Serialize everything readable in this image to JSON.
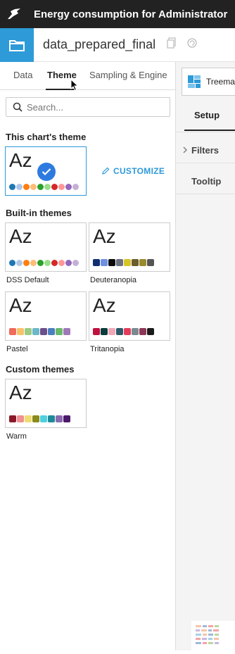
{
  "app": {
    "title": "Energy consumption for Administrator",
    "dataset_name": "data_prepared_final"
  },
  "tabs": [
    {
      "label": "Data"
    },
    {
      "label": "Theme"
    },
    {
      "label": "Sampling & Engine"
    }
  ],
  "search": {
    "placeholder": "Search..."
  },
  "current_theme": {
    "section_title": "This chart's theme",
    "sample_text": "Az",
    "customize_label": "CUSTOMIZE",
    "colors": [
      "#1f77b4",
      "#aec7e8",
      "#ff7f0e",
      "#ffbb78",
      "#2ca02c",
      "#98df8a",
      "#d62728",
      "#ff9896",
      "#9467bd",
      "#c5b0d5"
    ]
  },
  "builtin": {
    "section_title": "Built-in themes",
    "themes": [
      {
        "name": "DSS Default",
        "sample_text": "Az",
        "shape": "round",
        "colors": [
          "#1f77b4",
          "#aec7e8",
          "#ff7f0e",
          "#ffbb78",
          "#2ca02c",
          "#98df8a",
          "#d62728",
          "#ff9896",
          "#9467bd",
          "#c5b0d5"
        ]
      },
      {
        "name": "Deuteranopia",
        "sample_text": "Az",
        "shape": "square",
        "colors": [
          "#0f2f6e",
          "#6f8fe0",
          "#0b0b0b",
          "#6c6f7c",
          "#d6c426",
          "#6b5d2e",
          "#9a8a2e",
          "#555555"
        ]
      },
      {
        "name": "Pastel",
        "sample_text": "Az",
        "shape": "square",
        "colors": [
          "#ef6b5b",
          "#f8c26a",
          "#9ccb86",
          "#6cb8c8",
          "#6b4f8b",
          "#4c7fbf",
          "#6ab86b",
          "#a078b8"
        ]
      },
      {
        "name": "Tritanopia",
        "sample_text": "Az",
        "shape": "square",
        "colors": [
          "#c0123f",
          "#0a3c3d",
          "#f0a8b8",
          "#2e5a6a",
          "#e53c5c",
          "#7b8a90",
          "#8e3657",
          "#1b1b1b"
        ]
      }
    ]
  },
  "custom": {
    "section_title": "Custom themes",
    "themes": [
      {
        "name": "Warm",
        "sample_text": "Az",
        "shape": "square",
        "colors": [
          "#8a1a2a",
          "#f09090",
          "#f0dc70",
          "#8a8b1a",
          "#4fd0e0",
          "#1d8a9a",
          "#8a6ab0",
          "#4b1a6a"
        ]
      }
    ]
  },
  "right": {
    "chart_type_label": "Treemap",
    "setup_label": "Setup",
    "filters_label": "Filters",
    "tooltip_label": "Tooltip"
  }
}
